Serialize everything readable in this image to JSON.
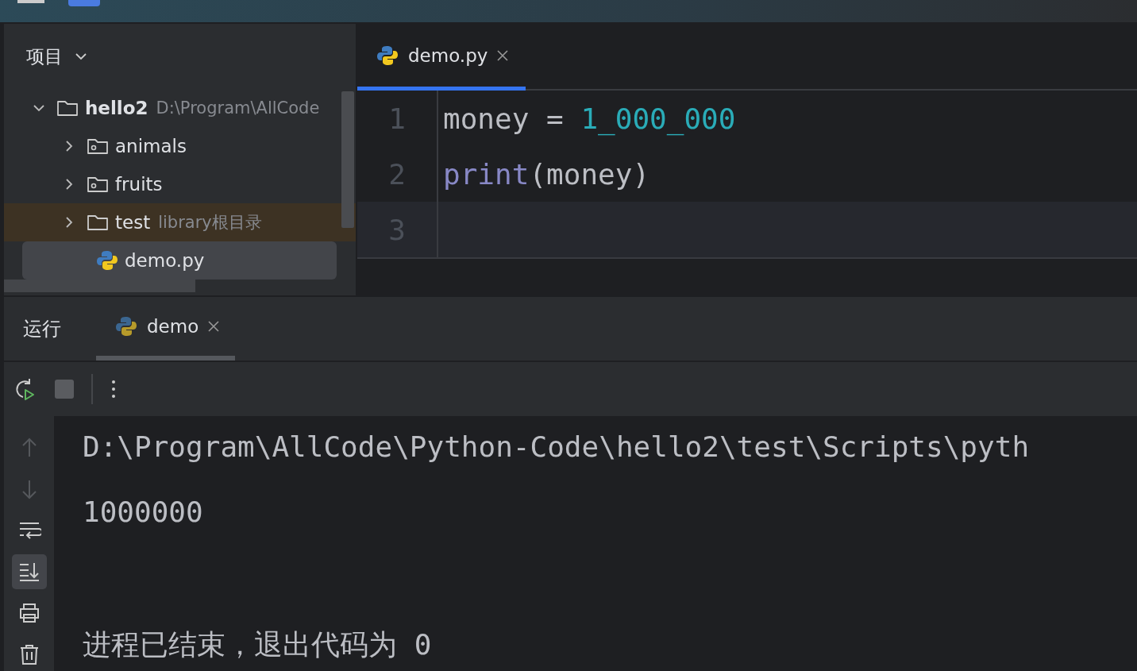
{
  "project_panel": {
    "title": "项目",
    "tree": [
      {
        "name": "hello2",
        "note": "D:\\Program\\AllCode",
        "kind": "folder",
        "expanded": true,
        "highlighted": false,
        "selected": false,
        "children": [
          {
            "name": "animals",
            "kind": "package",
            "expanded": false,
            "highlighted": false,
            "selected": false
          },
          {
            "name": "fruits",
            "kind": "package",
            "expanded": false,
            "highlighted": false,
            "selected": false
          },
          {
            "name": "test",
            "note": "library根目录",
            "kind": "folder",
            "expanded": false,
            "highlighted": true,
            "selected": false
          },
          {
            "name": "demo.py",
            "kind": "python",
            "highlighted": false,
            "selected": true
          }
        ]
      }
    ]
  },
  "editor": {
    "tabs": [
      {
        "label": "demo.py",
        "selected": true
      }
    ],
    "lines": [
      {
        "number": "1",
        "current": false,
        "tokens": [
          {
            "kind": "plain",
            "text": "money = "
          },
          {
            "kind": "number",
            "text": "1_000_000"
          }
        ]
      },
      {
        "number": "2",
        "current": false,
        "tokens": [
          {
            "kind": "builtin",
            "text": "print"
          },
          {
            "kind": "plain",
            "text": "(money)"
          }
        ]
      },
      {
        "number": "3",
        "current": true
      }
    ]
  },
  "run_panel": {
    "title": "运行",
    "tabs": [
      {
        "label": "demo",
        "selected": true
      }
    ],
    "tools": [
      {
        "kind": "up",
        "disabled": true,
        "selected": false
      },
      {
        "kind": "down",
        "disabled": true,
        "selected": false
      },
      {
        "kind": "wrap",
        "disabled": false,
        "selected": false
      },
      {
        "kind": "scroll-end",
        "disabled": false,
        "selected": true
      },
      {
        "kind": "print",
        "disabled": false,
        "selected": false
      },
      {
        "kind": "trash",
        "disabled": false,
        "selected": false
      }
    ],
    "output": [
      {
        "kind": "text",
        "text": "D:\\Program\\AllCode\\Python-Code\\hello2\\test\\Scripts\\pyth"
      },
      {
        "kind": "text",
        "text": "1000000"
      },
      {
        "kind": "exit",
        "text": "进程已结束，退出代码为 0"
      }
    ]
  }
}
